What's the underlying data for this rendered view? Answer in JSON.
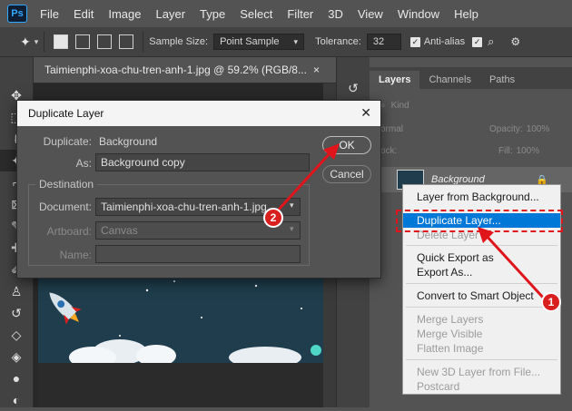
{
  "app": {
    "logo": "Ps"
  },
  "menu": [
    "File",
    "Edit",
    "Image",
    "Layer",
    "Type",
    "Select",
    "Filter",
    "3D",
    "View",
    "Window",
    "Help"
  ],
  "options": {
    "sample_size_label": "Sample Size:",
    "sample_size_value": "Point Sample",
    "tolerance_label": "Tolerance:",
    "tolerance_value": "32",
    "antialias_label": "Anti-alias"
  },
  "document": {
    "tab_title": "Taimienphi-xoa-chu-tren-anh-1.jpg @ 59.2% (RGB/8...",
    "close": "×"
  },
  "panel": {
    "tabs": [
      "Layers",
      "Channels",
      "Paths"
    ],
    "kind_label": "Kind",
    "blend_mode": "ormal",
    "opacity_label": "Opacity:",
    "opacity_value": "100%",
    "lock_label": "ock:",
    "fill_label": "Fill:",
    "fill_value": "100%",
    "layer_name": "Background"
  },
  "context_menu": {
    "items": [
      {
        "label": "Layer from Background...",
        "state": "normal"
      },
      {
        "label": "Duplicate Layer...",
        "state": "selected"
      },
      {
        "label": "Delete Layer",
        "state": "disabled"
      },
      {
        "label": "Quick Export as",
        "state": "normal"
      },
      {
        "label": "Export As...",
        "state": "normal"
      },
      {
        "label": "Convert to Smart Object",
        "state": "normal"
      },
      {
        "label": "Merge Layers",
        "state": "disabled"
      },
      {
        "label": "Merge Visible",
        "state": "disabled"
      },
      {
        "label": "Flatten Image",
        "state": "disabled"
      },
      {
        "label": "New 3D Layer from File...",
        "state": "disabled"
      },
      {
        "label": "Postcard",
        "state": "disabled"
      }
    ]
  },
  "dialog": {
    "title": "Duplicate Layer",
    "close": "✕",
    "duplicate_label": "Duplicate:",
    "duplicate_value": "Background",
    "as_label": "As:",
    "as_value": "Background copy",
    "destination_label": "Destination",
    "document_label": "Document:",
    "document_value": "Taimienphi-xoa-chu-tren-anh-1.jpg",
    "artboard_label": "Artboard:",
    "artboard_value": "Canvas",
    "name_label": "Name:",
    "name_value": "",
    "ok_label": "OK",
    "cancel_label": "Cancel"
  },
  "annotations": {
    "step1": "1",
    "step2": "2",
    "arrow_color": "#e0141b"
  }
}
